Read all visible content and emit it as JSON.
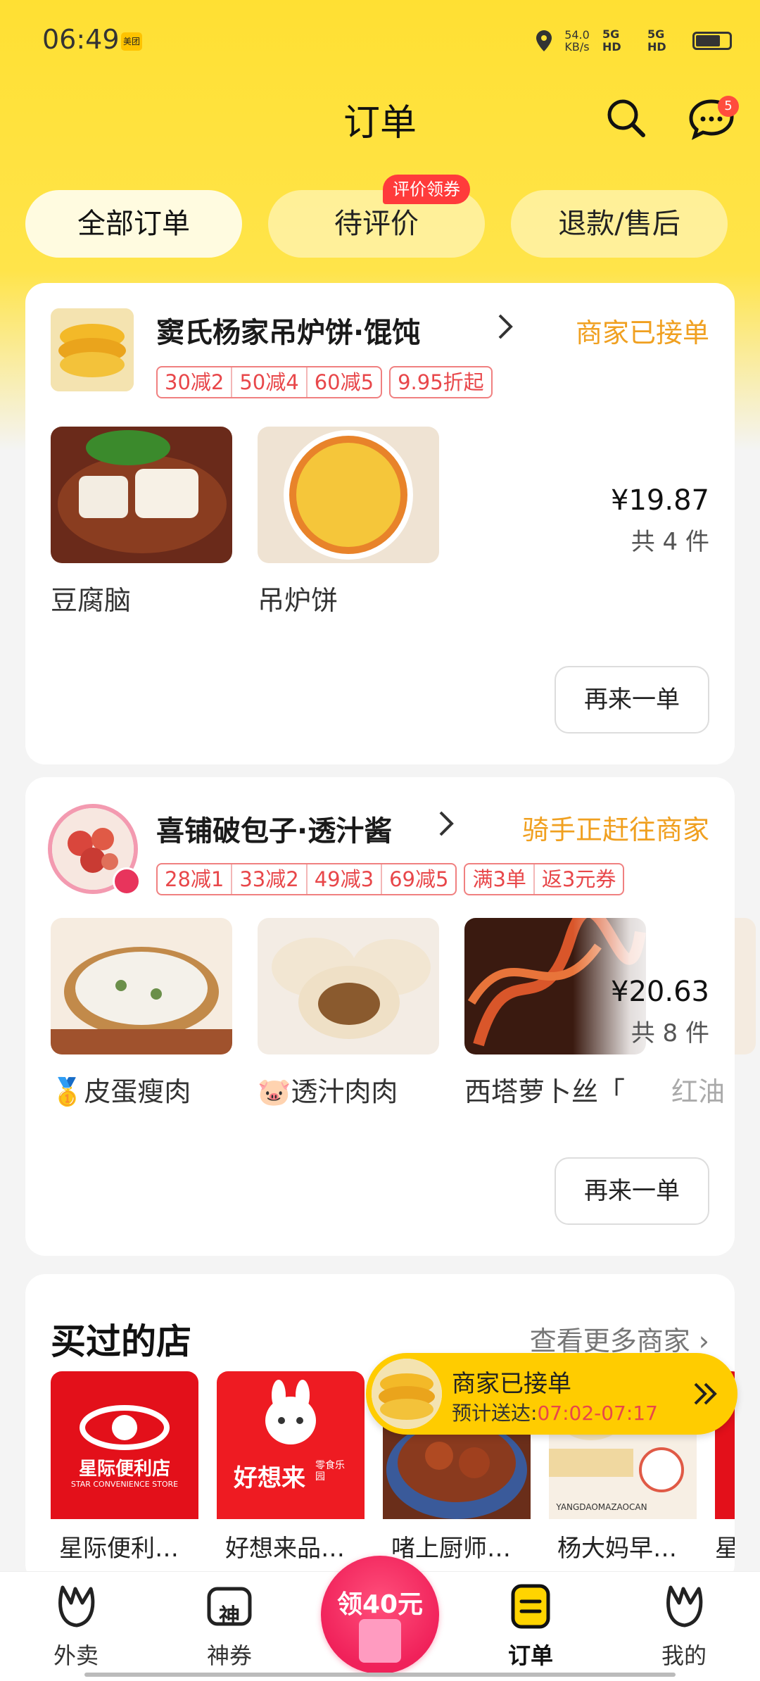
{
  "status_bar": {
    "time": "06:49",
    "app_badge": "美团",
    "net_speed": "54.0",
    "net_unit": "KB/s",
    "signal1": "5G HD",
    "signal2": "5G HD"
  },
  "header": {
    "title": "订单",
    "message_count": "5"
  },
  "tabs": [
    {
      "label": "全部订单",
      "active": true
    },
    {
      "label": "待评价",
      "active": false
    },
    {
      "label": "退款/售后",
      "active": false
    }
  ],
  "tab_badge": "评价领券",
  "orders": [
    {
      "shop_name": "窦氏杨家吊炉饼·馄饨",
      "status": "商家已接单",
      "promos": [
        "30减2",
        "50减4",
        "60减5"
      ],
      "promo_extra": "9.95折起",
      "items": [
        "豆腐脑",
        "吊炉饼"
      ],
      "price": "¥19.87",
      "count": "共 4 件",
      "reorder_label": "再来一单"
    },
    {
      "shop_name": "喜铺破包子·透汁酱",
      "status": "骑手正赶往商家",
      "promos": [
        "28减1",
        "33减2",
        "49减3",
        "69减5"
      ],
      "promo_extra": [
        "满3单",
        "返3元券"
      ],
      "items": [
        "🥇皮蛋瘦肉",
        "🐷透汁肉肉",
        "西塔萝卜丝「",
        "红油"
      ],
      "price": "¥20.63",
      "count": "共 8 件",
      "reorder_label": "再来一单"
    }
  ],
  "bought_section": {
    "title": "买过的店",
    "more": "查看更多商家",
    "shops": [
      "星际便利…",
      "好想来品…",
      "啫上厨师…",
      "杨大妈早…",
      "星"
    ],
    "logo_text": {
      "star": "星际便利店",
      "star_sub": "STAR CONVENIENCE STORE",
      "hxl": "好想来",
      "hxl_sub": "零食乐园",
      "ydm": "YANGDAOMAZAOCAN"
    }
  },
  "floating_status": {
    "title": "商家已接单",
    "eta_label": "预计送达:",
    "eta_time": "07:02-07:17"
  },
  "bottom_nav": {
    "items": [
      "外卖",
      "神券",
      "订单",
      "我的"
    ],
    "coupon": "领40元",
    "coupon_icon_char": "神"
  },
  "colors": {
    "accent_yellow": "#ffe033",
    "status_orange": "#f0a020",
    "promo_red": "#e8474a"
  }
}
